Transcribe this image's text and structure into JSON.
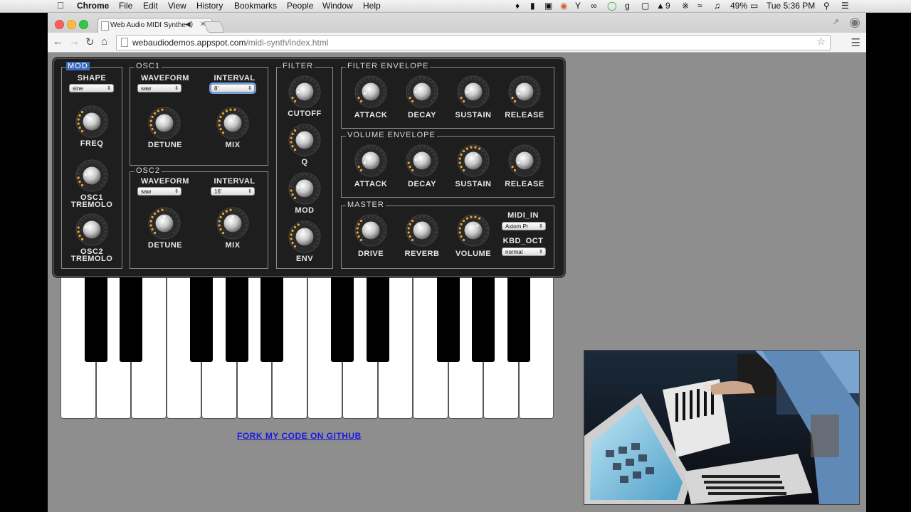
{
  "menubar": {
    "app_name": "Chrome",
    "items": [
      "File",
      "Edit",
      "View",
      "History",
      "Bookmarks",
      "People",
      "Window",
      "Help"
    ],
    "battery": "49%",
    "clock": "Tue 5:36 PM",
    "badge_count": "9"
  },
  "browser": {
    "tab_title": "Web Audio MIDI Synthe",
    "url_host": "webaudiodemos.appspot.com",
    "url_path": "/midi-synth/index.html"
  },
  "synth": {
    "mod": {
      "title": "MOD",
      "shape_label": "SHAPE",
      "shape_value": "sine",
      "freq_label": "FREQ",
      "osc1_tremolo_label": "OSC1\nTREMOLO",
      "osc2_tremolo_label": "OSC2\nTREMOLO"
    },
    "osc1": {
      "title": "OSC1",
      "waveform_label": "WAVEFORM",
      "waveform_value": "saw",
      "interval_label": "INTERVAL",
      "interval_value": "8'",
      "detune_label": "DETUNE",
      "mix_label": "MIX"
    },
    "osc2": {
      "title": "OSC2",
      "waveform_label": "WAVEFORM",
      "waveform_value": "saw",
      "interval_label": "INTERVAL",
      "interval_value": "16'",
      "detune_label": "DETUNE",
      "mix_label": "MIX"
    },
    "filter": {
      "title": "FILTER",
      "cutoff_label": "CUTOFF",
      "q_label": "Q",
      "mod_label": "MOD",
      "env_label": "ENV"
    },
    "filter_envelope": {
      "title": "FILTER ENVELOPE",
      "attack_label": "ATTACK",
      "decay_label": "DECAY",
      "sustain_label": "SUSTAIN",
      "release_label": "RELEASE"
    },
    "volume_envelope": {
      "title": "VOLUME ENVELOPE",
      "attack_label": "ATTACK",
      "decay_label": "DECAY",
      "sustain_label": "SUSTAIN",
      "release_label": "RELEASE"
    },
    "master": {
      "title": "MASTER",
      "drive_label": "DRIVE",
      "reverb_label": "REVERB",
      "volume_label": "VOLUME",
      "midi_in_label": "MIDI_IN",
      "midi_in_value": "Axiom Pr",
      "kbd_oct_label": "KBD_OCT",
      "kbd_oct_value": "normal"
    }
  },
  "knob_levels": {
    "mod_freq": 0.35,
    "osc1_tremolo": 0.2,
    "osc2_tremolo": 0.25,
    "osc1_detune": 0.5,
    "osc1_mix": 0.55,
    "osc2_detune": 0.5,
    "osc2_mix": 0.5,
    "filter_cutoff": 0.15,
    "filter_q": 0.35,
    "filter_mod": 0.2,
    "filter_env": 0.45,
    "fenv_attack": 0.1,
    "fenv_decay": 0.15,
    "fenv_sustain": 0.15,
    "fenv_release": 0.1,
    "venv_attack": 0.1,
    "venv_decay": 0.2,
    "venv_sustain": 0.6,
    "venv_release": 0.1,
    "master_drive": 0.35,
    "master_reverb": 0.4,
    "master_volume": 0.65
  },
  "github_link": "FORK MY CODE ON GITHUB",
  "colors": {
    "knob_led": "#f0a830",
    "panel_bg": "#1e1e1e",
    "link": "#1a1ae0"
  }
}
